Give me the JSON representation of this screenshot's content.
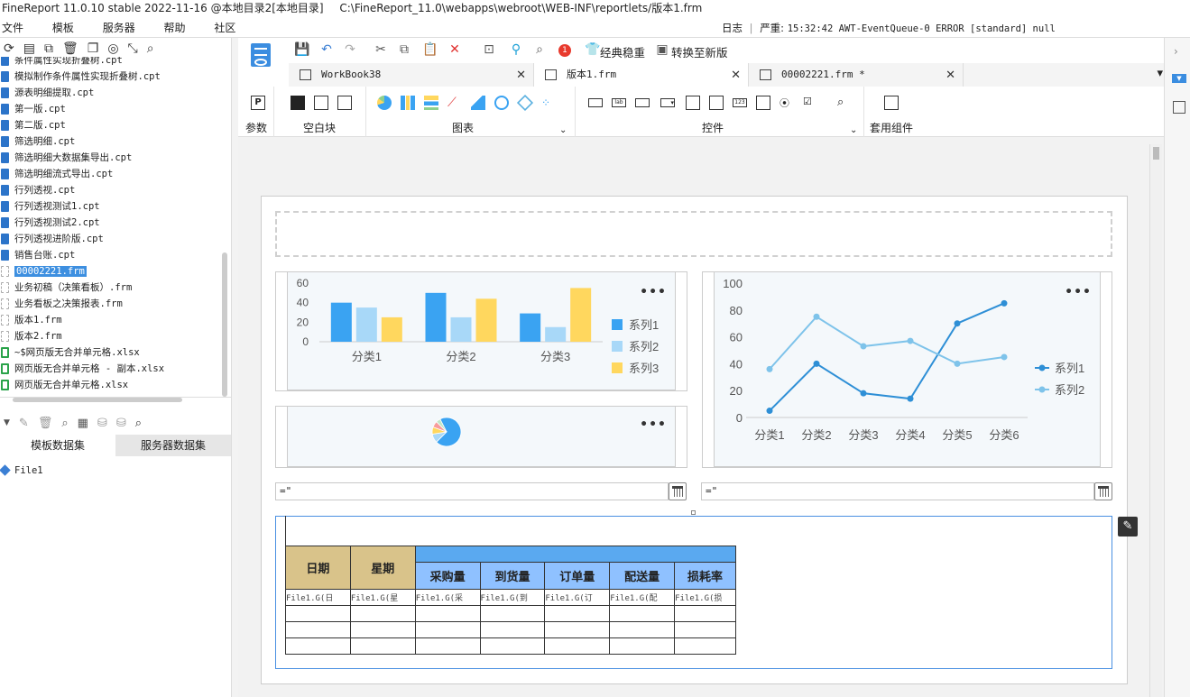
{
  "window": {
    "title": "FineReport 11.0.10 stable 2022-11-16 @本地目录2[本地目录]",
    "path": "C:\\FineReport_11.0\\webapps\\webroot\\WEB-INF\\reportlets/版本1.frm"
  },
  "menu": [
    "文件",
    "模板",
    "服务器",
    "帮助",
    "社区"
  ],
  "status": {
    "log_label": "日志",
    "severity": "严重:",
    "message": "15:32:42 AWT-EventQueue-0 ERROR [standard] null"
  },
  "file_tree": [
    {
      "name": "条件属性实现折叠树.cpt",
      "type": "cpt"
    },
    {
      "name": "模拟制作条件属性实现折叠树.cpt",
      "type": "cpt"
    },
    {
      "name": "源表明细提取.cpt",
      "type": "cpt"
    },
    {
      "name": "第一版.cpt",
      "type": "cpt"
    },
    {
      "name": "第二版.cpt",
      "type": "cpt"
    },
    {
      "name": "筛选明细.cpt",
      "type": "cpt"
    },
    {
      "name": "筛选明细大数据集导出.cpt",
      "type": "cpt"
    },
    {
      "name": "筛选明细流式导出.cpt",
      "type": "cpt"
    },
    {
      "name": "行列透视.cpt",
      "type": "cpt"
    },
    {
      "name": "行列透视测试1.cpt",
      "type": "cpt"
    },
    {
      "name": "行列透视测试2.cpt",
      "type": "cpt"
    },
    {
      "name": "行列透视进阶版.cpt",
      "type": "cpt"
    },
    {
      "name": "销售台账.cpt",
      "type": "cpt"
    },
    {
      "name": "00002221.frm",
      "type": "frm",
      "selected": true
    },
    {
      "name": "业务初稿（决策看板）.frm",
      "type": "frm"
    },
    {
      "name": "业务看板之决策报表.frm",
      "type": "frm"
    },
    {
      "name": "版本1.frm",
      "type": "frm"
    },
    {
      "name": "版本2.frm",
      "type": "frm"
    },
    {
      "name": "~$网页版无合并单元格.xlsx",
      "type": "xls"
    },
    {
      "name": "网页版无合并单元格 - 副本.xlsx",
      "type": "xls"
    },
    {
      "name": "网页版无合并单元格.xlsx",
      "type": "xls"
    }
  ],
  "dataset_tabs": {
    "template": "模板数据集",
    "server": "服务器数据集"
  },
  "dataset_item": "File1",
  "toolbar": {
    "classic": "经典稳重",
    "convert": "转换至新版",
    "badge": "1"
  },
  "doc_tabs": [
    {
      "label": "WorkBook38",
      "active": false
    },
    {
      "label": "版本1.frm",
      "active": true
    },
    {
      "label": "00002221.frm *",
      "active": false
    }
  ],
  "widget_groups": {
    "param": "参数",
    "blank": "空白块",
    "chart": "图表",
    "control": "控件",
    "common": "套用组件"
  },
  "date_inputs": [
    "=\"",
    "=\""
  ],
  "chart_data": [
    {
      "type": "bar",
      "categories": [
        "分类1",
        "分类2",
        "分类3"
      ],
      "ylim": [
        0,
        60
      ],
      "yticks": [
        0,
        20,
        40,
        60
      ],
      "series": [
        {
          "name": "系列1",
          "values": [
            40,
            50,
            29
          ],
          "color": "#3aa3f2"
        },
        {
          "name": "系列2",
          "values": [
            35,
            25,
            15
          ],
          "color": "#a8d8f8"
        },
        {
          "name": "系列3",
          "values": [
            25,
            44,
            55
          ],
          "color": "#ffd75e"
        }
      ],
      "legend": "right"
    },
    {
      "type": "pie",
      "values": [
        70,
        10,
        8,
        7,
        5
      ],
      "colors": [
        "#3aa3f2",
        "#a8d8f8",
        "#ffd75e",
        "#f79c9c",
        "#c0e6c8"
      ]
    },
    {
      "type": "line",
      "categories": [
        "分类1",
        "分类2",
        "分类3",
        "分类4",
        "分类5",
        "分类6"
      ],
      "ylim": [
        0,
        100
      ],
      "yticks": [
        0,
        20,
        40,
        60,
        80,
        100
      ],
      "series": [
        {
          "name": "系列1",
          "values": [
            5,
            40,
            18,
            14,
            70,
            85
          ],
          "color": "#2e8fd6"
        },
        {
          "name": "系列2",
          "values": [
            36,
            75,
            53,
            57,
            40,
            45
          ],
          "color": "#7ec3ea"
        }
      ],
      "legend": "right"
    }
  ],
  "report_table": {
    "headers_fixed": [
      "日期",
      "星期"
    ],
    "headers_group": [
      "采购量",
      "到货量",
      "订单量",
      "配送量",
      "损耗率"
    ],
    "formula_row": [
      "File1.G(日",
      "File1.G(星",
      "File1.G(采",
      "File1.G(到",
      "File1.G(订",
      "File1.G(配",
      "File1.G(损"
    ]
  }
}
